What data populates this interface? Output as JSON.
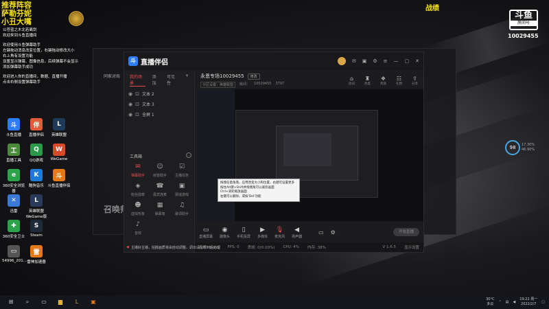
{
  "overlay": {
    "left_lines": [
      "推荐阵容",
      "萨勒芬妮",
      "小丑大嘴"
    ],
    "right_title": "战绩",
    "room_logo_top": "斗鱼",
    "room_logo_bottom": "房间号",
    "room_number": "10029455"
  },
  "chat": {
    "lines": [
      "以苍蓝之木北若离剑",
      "欢迎来到斗鱼直播间",
      "欢迎使用斗鱼弹幕助手",
      "左键拖动消息改变位置，右键拖动修改大小",
      "右上角有设置功能",
      "设置显示弹幕、图像信息，后续弹幕不会显示",
      "添加弹幕助手成功",
      "欢迎进入你的直播间，数据、直播开播",
      "点击右侧设置弹幕助手"
    ]
  },
  "desktop_icons": [
    {
      "label": "斗鱼直播",
      "color": "#2d7df6",
      "glyph": "斗"
    },
    {
      "label": "直播伴侣",
      "color": "#e25c3a",
      "glyph": "伴"
    },
    {
      "label": "英雄联盟",
      "color": "#1e3a5a",
      "glyph": "L"
    },
    {
      "label": "直播工具",
      "color": "#4a8a3a",
      "glyph": "工"
    },
    {
      "label": "QQ游戏",
      "color": "#2a9a4a",
      "glyph": "Q"
    },
    {
      "label": "WeGame",
      "color": "#d64a2a",
      "glyph": "W"
    },
    {
      "label": "360安全浏览器",
      "color": "#2ca24a",
      "glyph": "e"
    },
    {
      "label": "酷狗音乐",
      "color": "#1e7ad6",
      "glyph": "K"
    },
    {
      "label": "斗鱼直播伴侣",
      "color": "#e27a1a",
      "glyph": "斗"
    },
    {
      "label": "迅雷",
      "color": "#3a7ad6",
      "glyph": "✕"
    },
    {
      "label": "英雄联盟WeGame版",
      "color": "#2a3a5a",
      "glyph": "L"
    },
    {
      "label": "",
      "color": "transparent",
      "glyph": ""
    },
    {
      "label": "360安全卫士",
      "color": "#2ca24a",
      "glyph": "✚"
    },
    {
      "label": "Steam",
      "color": "#1e2a3a",
      "glyph": "S"
    },
    {
      "label": "",
      "color": "transparent",
      "glyph": ""
    },
    {
      "label": "54996_201...",
      "color": "#555",
      "glyph": "▭"
    },
    {
      "label": "雷神加速器",
      "color": "#e27a1a",
      "glyph": "雷"
    },
    {
      "label": "",
      "color": "transparent",
      "glyph": ""
    }
  ],
  "window": {
    "brand": "直播伴侣",
    "left_tabs": [
      "我的场景",
      "添加",
      "可见性"
    ],
    "sources": [
      "文本 2",
      "文本 3",
      "全屏 1"
    ],
    "tools_title": "工具箱",
    "tools": [
      {
        "label": "弹幕助手",
        "glyph": "✉",
        "active": true
      },
      {
        "label": "房管助手",
        "glyph": "☺",
        "active": false
      },
      {
        "label": "主播任务",
        "glyph": "☑",
        "active": false
      },
      {
        "label": "粉丝勋章",
        "glyph": "◈",
        "active": false
      },
      {
        "label": "嘉宾连麦",
        "glyph": "☎",
        "active": false
      },
      {
        "label": "猜谜游戏",
        "glyph": "▣",
        "active": false
      },
      {
        "label": "虚拟形象",
        "glyph": "☻",
        "active": false
      },
      {
        "label": "弹幕墙",
        "glyph": "▦",
        "active": false
      },
      {
        "label": "歌词助手",
        "glyph": "♫",
        "active": false
      },
      {
        "label": "音效",
        "glyph": "♪",
        "active": false
      },
      {
        "label": "",
        "glyph": "",
        "active": false
      },
      {
        "label": "",
        "glyph": "",
        "active": false
      }
    ],
    "room_title": "永恩专场10029455",
    "edit_label": "修改",
    "room_sub_tag": "分区设置：英雄联盟",
    "room_id_label": "房间：",
    "room_id": "10029455",
    "room_fans": "3797",
    "info_icons": [
      {
        "glyph": "⌂",
        "label": "房间"
      },
      {
        "glyph": "♜",
        "label": "热度"
      },
      {
        "glyph": "❖",
        "label": "贵族"
      },
      {
        "glyph": "☷",
        "label": "礼物"
      },
      {
        "glyph": "⇪",
        "label": "分享"
      }
    ],
    "tooltip_lines": [
      "拖拽任意角落，应用改变大小和位置，右键可设置更多",
      "按住Alt键+Shift并拖拽角可以裁剪画面",
      "Ctrl+滚轮缩放画面",
      "右键可以删除，或按'Del'功能"
    ],
    "controls": [
      {
        "label": "直播屏幕",
        "glyph": "▭"
      },
      {
        "label": "摄像头",
        "glyph": "◉"
      },
      {
        "label": "手机投屏",
        "glyph": "▯"
      },
      {
        "label": "多媒体",
        "glyph": "▶"
      },
      {
        "label": "麦克风",
        "glyph": "🎙",
        "mic": true
      },
      {
        "label": "扬声器",
        "glyph": "◀"
      }
    ],
    "start_label": "开始直播",
    "notice_left": "主播好主播，拍摄画质将由自动调整，调出请及时到后处理",
    "status": [
      "码率: 0kb/s",
      "FPS: 0",
      "丢帧: 0(0.00%)",
      "CPU: 4%",
      "内存: 38%"
    ],
    "version": "V 1.6.5",
    "bottom_right": "显示设置"
  },
  "side_window": {
    "tab_label": "同家对局",
    "bottom_text": "召唤师"
  },
  "meter": {
    "value": "98",
    "line1": "17.30%",
    "line2": "46.90%"
  },
  "taskbar": {
    "weather": "30°C",
    "weather_desc": "多云",
    "time": "19:22",
    "weekday": "周一",
    "date": "2022/2/7"
  }
}
